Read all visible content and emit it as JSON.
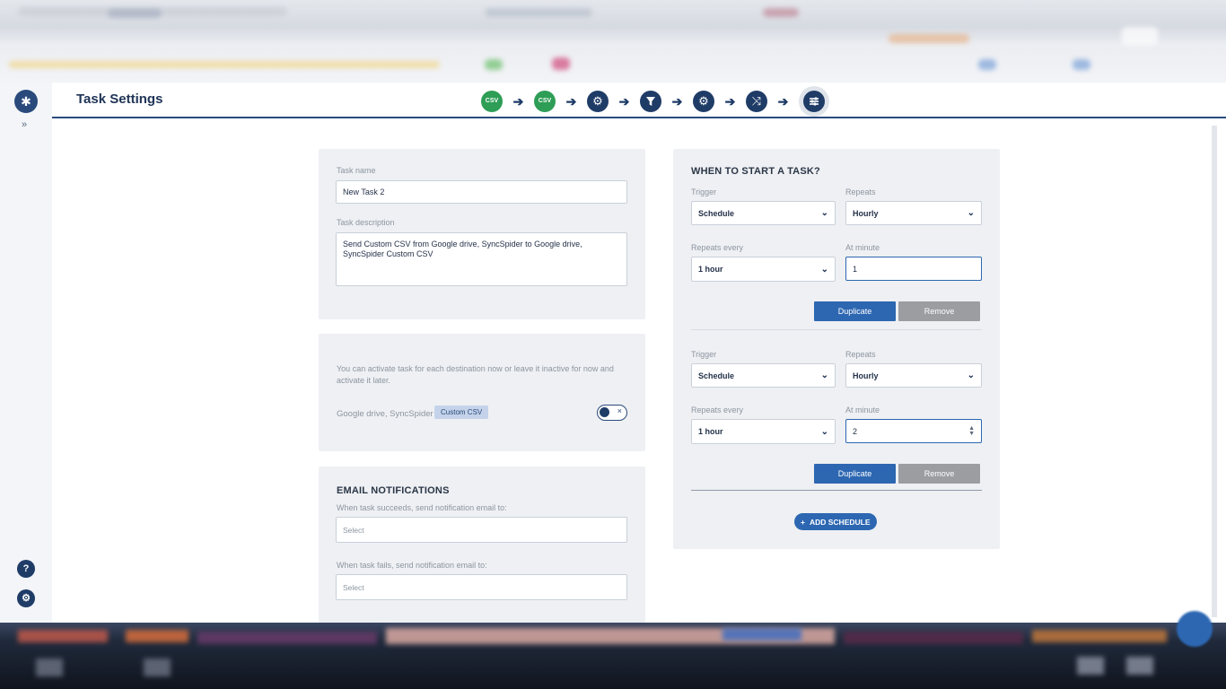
{
  "header": {
    "title": "Task Settings",
    "steps": [
      {
        "icon": "csv-badge-icon",
        "label": "CSV"
      },
      {
        "icon": "csv-badge-icon",
        "label": "CSV"
      },
      {
        "icon": "gear-icon"
      },
      {
        "icon": "filter-icon"
      },
      {
        "icon": "gear-icon"
      },
      {
        "icon": "shuffle-icon"
      },
      {
        "icon": "sliders-icon"
      }
    ]
  },
  "sidebar": {
    "expand": "»",
    "help": "?",
    "settings": "⚙"
  },
  "task": {
    "name_label": "Task name",
    "name_value": "New Task 2",
    "description_label": "Task description",
    "description_value": "Send Custom CSV from Google drive, SyncSpider to Google drive, SyncSpider Custom CSV"
  },
  "activation": {
    "help_text": "You can activate task for each destination now or leave it inactive for now and activate it later.",
    "destination": "Google drive, SyncSpider",
    "tag": "Custom CSV",
    "toggle_mark": "×"
  },
  "email": {
    "title": "EMAIL NOTIFICATIONS",
    "success_label": "When task succeeds, send notification email to:",
    "success_placeholder": "Select",
    "failure_label": "When task fails, send notification email to:",
    "failure_placeholder": "Select"
  },
  "schedule": {
    "title": "WHEN TO START A TASK?",
    "trigger_label": "Trigger",
    "repeats_label": "Repeats",
    "repeats_every_label": "Repeats every",
    "at_minute_label": "At minute",
    "duplicate_label": "Duplicate",
    "remove_label": "Remove",
    "add_label": "ADD SCHEDULE",
    "items": [
      {
        "trigger": "Schedule",
        "repeats": "Hourly",
        "every": "1 hour",
        "minute": "1"
      },
      {
        "trigger": "Schedule",
        "repeats": "Hourly",
        "every": "1 hour",
        "minute": "2"
      }
    ]
  },
  "colors": {
    "accent": "#2d67b2",
    "navy": "#1f3c67",
    "csv_green": "#2e9e56",
    "panel": "#eef0f3"
  }
}
